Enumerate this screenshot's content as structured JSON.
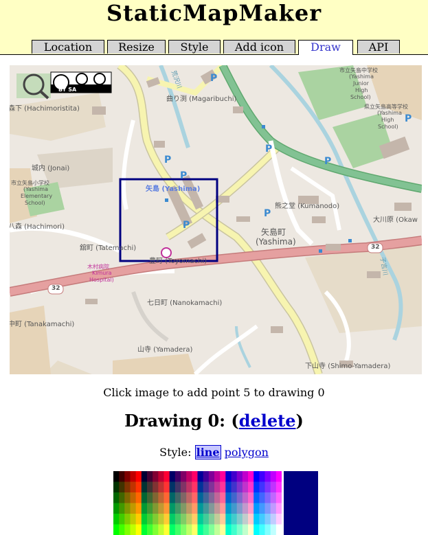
{
  "app": {
    "title": "StaticMapMaker"
  },
  "tabs": [
    {
      "label": "Location"
    },
    {
      "label": "Resize"
    },
    {
      "label": "Style"
    },
    {
      "label": "Add icon"
    },
    {
      "label": "Draw"
    },
    {
      "label": "API"
    }
  ],
  "active_tab": "Draw",
  "map": {
    "license_badge": "BY SA",
    "labels": {
      "hachimoristita": "森下 (Hachimoristita)",
      "magaribuchi": "曲り渕 (Magaribuchi)",
      "jonai": "城内 (Jonai)",
      "yashima_school_1": "市立矢島小学校",
      "yashima_school_2": "(Yashima",
      "yashima_school_3": "Elementary",
      "yashima_school_4": "School)",
      "yashima_junior_1": "市立矢島中学校",
      "yashima_junior_2": "(Yashima",
      "yashima_junior_3": "Junior",
      "yashima_junior_4": "High",
      "yashima_junior_5": "School)",
      "yashima_high_1": "県立矢島高等学校",
      "yashima_high_2": "(Yashima",
      "yashima_high_3": "High",
      "yashima_high_4": "School)",
      "yashima_station": "矢島 (Yashima)",
      "kumanodo": "熊之堂 (Kumanodo)",
      "hachimori": "八森 (Hachimori)",
      "tatemachi": "舘町 (Tatemachi)",
      "yashima_town_1": "矢島町",
      "yashima_town_2": "(Yashima)",
      "okawara": "大川原 (Okaw",
      "hospital_1": "木村病院",
      "hospital_2": "Kimura",
      "hospital_3": "Hospital)",
      "toyomachi": "豊町 (Toyomachi)",
      "nanokamachi": "七日町 (Nanokamachi)",
      "tanakamachi": "中町 (Tanakamachi)",
      "yamadera": "山寺 (Yamadera)",
      "shimo_yamadera": "下山寺 (Shimo-Yamadera)",
      "route_32": "32",
      "river_1": "荒沢川",
      "river_2": "子吉川"
    }
  },
  "status": {
    "caption": "Click image to add point 5 to drawing 0",
    "drawing_title_prefix": "Drawing 0: (",
    "delete_label": "delete",
    "drawing_title_suffix": ")",
    "style_label": "Style:",
    "style_line": "line",
    "style_polygon": "polygon"
  },
  "colors": {
    "header_bg": "#ffffc4",
    "draw_stroke": "#000080",
    "selected_color": "#000080",
    "road_main": "#e5a0a0",
    "road_secondary": "#f7f4b0",
    "railway": "#82c293",
    "park": "#aad3a1",
    "water": "#aad3df",
    "land": "#ede8e1"
  }
}
